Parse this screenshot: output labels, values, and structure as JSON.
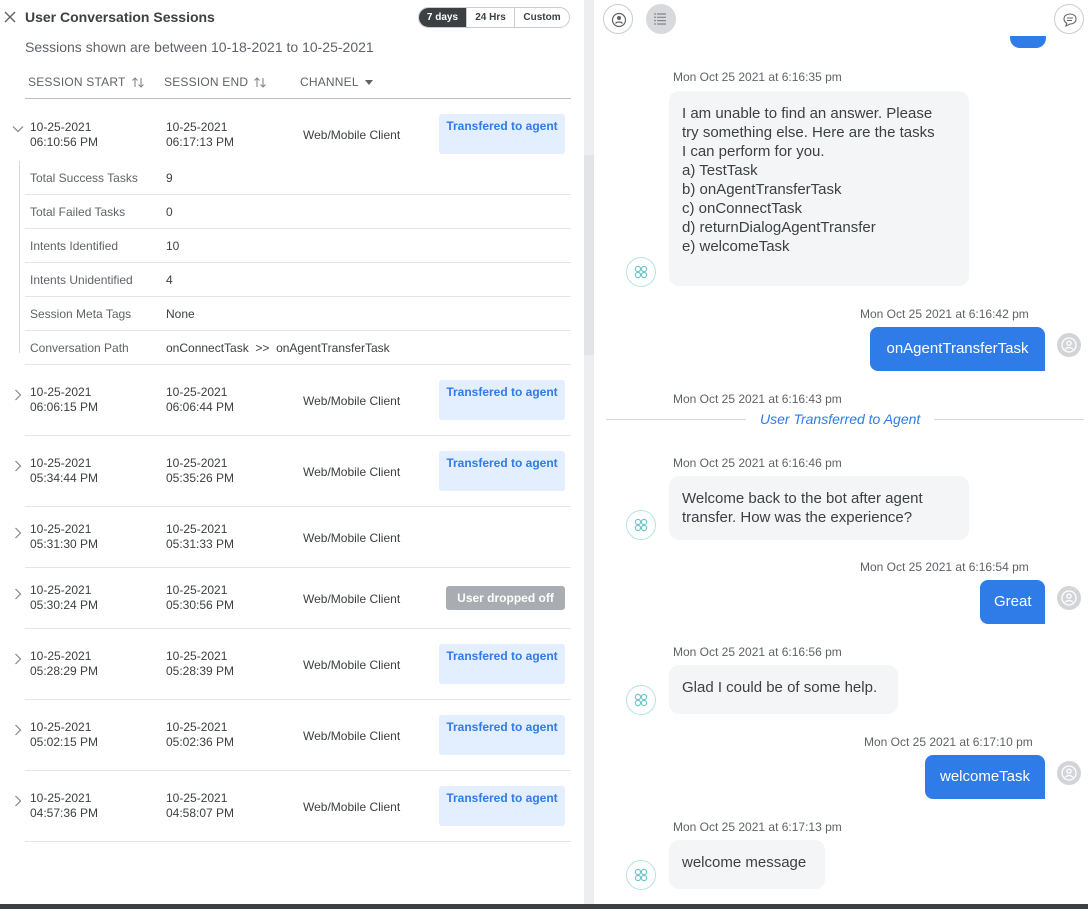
{
  "sessions_panel": {
    "title": "User Conversation Sessions",
    "range": {
      "seven_days": "7 days",
      "twenty_four_hrs": "24 Hrs",
      "custom": "Custom"
    },
    "subtitle": "Sessions shown are between 10-18-2021 to 10-25-2021",
    "columns": {
      "start": "SESSION START",
      "end": "SESSION END",
      "channel": "CHANNEL"
    },
    "sessions": [
      {
        "start_date": "10-25-2021",
        "start_time": "06:10:56 PM",
        "end_date": "10-25-2021",
        "end_time": "06:17:13 PM",
        "channel": "Web/Mobile Client",
        "status": "Transfered to agent"
      },
      {
        "start_date": "10-25-2021",
        "start_time": "06:06:15 PM",
        "end_date": "10-25-2021",
        "end_time": "06:06:44 PM",
        "channel": "Web/Mobile Client",
        "status": "Transfered to agent"
      },
      {
        "start_date": "10-25-2021",
        "start_time": "05:34:44 PM",
        "end_date": "10-25-2021",
        "end_time": "05:35:26 PM",
        "channel": "Web/Mobile Client",
        "status": "Transfered to agent"
      },
      {
        "start_date": "10-25-2021",
        "start_time": "05:31:30 PM",
        "end_date": "10-25-2021",
        "end_time": "05:31:33 PM",
        "channel": "Web/Mobile Client",
        "status": ""
      },
      {
        "start_date": "10-25-2021",
        "start_time": "05:30:24 PM",
        "end_date": "10-25-2021",
        "end_time": "05:30:56 PM",
        "channel": "Web/Mobile Client",
        "status": "User dropped off"
      },
      {
        "start_date": "10-25-2021",
        "start_time": "05:28:29 PM",
        "end_date": "10-25-2021",
        "end_time": "05:28:39 PM",
        "channel": "Web/Mobile Client",
        "status": "Transfered to agent"
      },
      {
        "start_date": "10-25-2021",
        "start_time": "05:02:15 PM",
        "end_date": "10-25-2021",
        "end_time": "05:02:36 PM",
        "channel": "Web/Mobile Client",
        "status": "Transfered to agent"
      },
      {
        "start_date": "10-25-2021",
        "start_time": "04:57:36 PM",
        "end_date": "10-25-2021",
        "end_time": "04:58:07 PM",
        "channel": "Web/Mobile Client",
        "status": "Transfered to agent"
      }
    ],
    "details": [
      {
        "label": "Total Success Tasks",
        "value": "9"
      },
      {
        "label": "Total Failed Tasks",
        "value": "0"
      },
      {
        "label": "Intents Identified",
        "value": "10"
      },
      {
        "label": "Intents Unidentified",
        "value": "4"
      },
      {
        "label": "Session Meta Tags",
        "value": "None"
      },
      {
        "label": "Conversation Path",
        "value": "onConnectTask  >>  onAgentTransferTask"
      }
    ]
  },
  "chat": {
    "messages": [
      {
        "timestamp": "Mon Oct 25 2021 at 6:16:35 pm",
        "lines": [
          "I am unable to find an answer. Please",
          "try something else. Here are the tasks",
          "I can perform for you.",
          "a) TestTask",
          "b) onAgentTransferTask",
          "c) onConnectTask",
          "d) returnDialogAgentTransfer",
          "e) welcomeTask"
        ]
      },
      {
        "timestamp": "Mon Oct 25 2021 at 6:16:42 pm",
        "text": "onAgentTransferTask"
      },
      {
        "timestamp": "Mon Oct 25 2021 at 6:16:43 pm",
        "event": "User Transferred to Agent"
      },
      {
        "timestamp": "Mon Oct 25 2021 at 6:16:46 pm",
        "lines": [
          "Welcome back to the bot after agent",
          "transfer. How was the experience?"
        ]
      },
      {
        "timestamp": "Mon Oct 25 2021 at 6:16:54 pm",
        "text": "Great"
      },
      {
        "timestamp": "Mon Oct 25 2021 at 6:16:56 pm",
        "lines": [
          "Glad I could be of some help."
        ]
      },
      {
        "timestamp": "Mon Oct 25 2021 at 6:17:10 pm",
        "text": "welcomeTask"
      },
      {
        "timestamp": "Mon Oct 25 2021 at 6:17:13 pm",
        "lines": [
          "welcome message"
        ]
      }
    ]
  },
  "colors": {
    "accent": "#2f7be8",
    "badge_bg": "#e3efff",
    "dropped_badge": "#a9acb0",
    "bot_bubble": "#f4f5f7"
  }
}
